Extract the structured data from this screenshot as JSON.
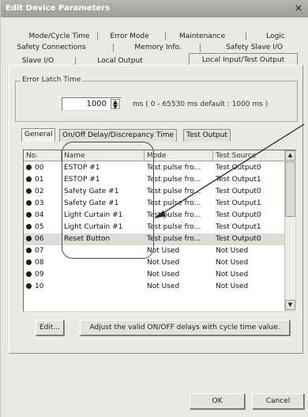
{
  "window": {
    "title": "Edit Device Parameters",
    "close_symbol": "×"
  },
  "tabs": {
    "row1": [
      "Mode/Cycle Time",
      "Error Mode",
      "Maintenance",
      "Logic"
    ],
    "row2": [
      "Safety Connections",
      "Memory Info.",
      "Safety Slave I/O"
    ],
    "row3": [
      "Slave I/O",
      "Local Output",
      "Local Input/Test Output"
    ],
    "active": "Local Input/Test Output"
  },
  "error_latch": {
    "legend": "Error Latch Time",
    "value": "1000",
    "unit_hint": "ms   ( 0 - 65530 ms   default : 1000 ms )"
  },
  "subtabs": [
    "General",
    "On/Off Delay/Discrepancy Time",
    "Test Output"
  ],
  "list": {
    "columns": [
      "No.",
      "Name",
      "Mode",
      "Test Source"
    ],
    "rows": [
      {
        "no": "00",
        "name": "ESTOP #1",
        "mode": "Test pulse fro...",
        "source": "Test Output0"
      },
      {
        "no": "01",
        "name": "ESTOP #1",
        "mode": "Test pulse fro...",
        "source": "Test Output1"
      },
      {
        "no": "02",
        "name": "Safety Gate #1",
        "mode": "Test pulse fro...",
        "source": "Test Output0"
      },
      {
        "no": "03",
        "name": "Safety Gate #1",
        "mode": "Test pulse fro...",
        "source": "Test Output1"
      },
      {
        "no": "04",
        "name": "Light Curtain #1",
        "mode": "Test pulse fro...",
        "source": "Test Output0"
      },
      {
        "no": "05",
        "name": "Light Curtain #1",
        "mode": "Test pulse fro...",
        "source": "Test Output1"
      },
      {
        "no": "06",
        "name": "Reset Button",
        "mode": "Test pulse fro...",
        "source": "Test Output0"
      },
      {
        "no": "07",
        "name": "",
        "mode": "Not Used",
        "source": "Not Used"
      },
      {
        "no": "08",
        "name": "",
        "mode": "Not Used",
        "source": "Not Used"
      },
      {
        "no": "09",
        "name": "",
        "mode": "Not Used",
        "source": "Not Used"
      },
      {
        "no": "10",
        "name": "",
        "mode": "Not Used",
        "source": "Not Used"
      }
    ],
    "selected_row": "06"
  },
  "buttons": {
    "edit": "Edit...",
    "adjust": "Adjust the valid ON/OFF delays with cycle time value.",
    "ok": "OK",
    "cancel": "Cancel"
  },
  "icons": {
    "close": "close-icon",
    "spin": "spin-arrows-icon",
    "bullet": "input-bullet-icon",
    "scroll_up": "scroll-up-arrow-icon",
    "scroll_down": "scroll-down-arrow-icon"
  }
}
